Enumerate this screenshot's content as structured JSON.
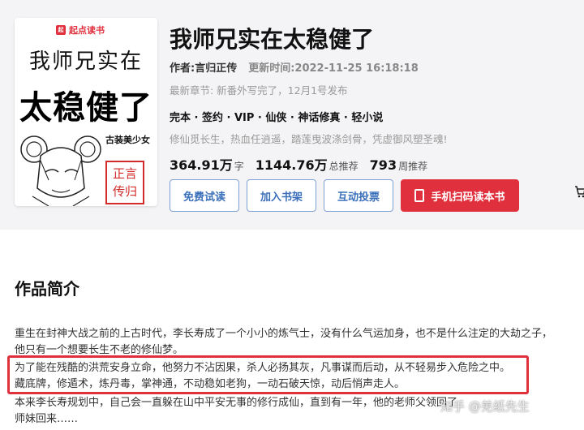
{
  "cover": {
    "logo_mark": "起点",
    "logo_text": "起点读书",
    "title_line1": "我师兄实在",
    "title_line2": "太稳健了",
    "tagline": "古装美少女",
    "seal_line1": "正言",
    "seal_line2": "传归"
  },
  "book": {
    "title": "我师兄实在太稳健了",
    "author_label": "作者:",
    "author": "言归正传",
    "updated_label": "更新时间:",
    "updated": "2022-11-25 16:18:18",
    "latest": "最新章节: 新番外写完了，12月1号发布",
    "tags": "完本 · 签约 · VIP · 仙侠 · 神话修真 · 轻小说",
    "description": "修仙觅长生，热血任逍遥，踏莲曳波涤剑骨，凭虚御风塑圣魂!",
    "stats": [
      {
        "value": "364.91万",
        "unit": "字"
      },
      {
        "value": "1144.76万",
        "unit": "总推荐"
      },
      {
        "value": "793",
        "unit": "周推荐"
      }
    ]
  },
  "actions": {
    "trial": "免费试读",
    "shelf": "加入书架",
    "vote": "互动投票",
    "scan": "手机扫码读本书"
  },
  "cart_icon": "cart-icon",
  "intro": {
    "heading": "作品简介",
    "lines": [
      "重生在封神大战之前的上古时代，李长寿成了一个小小的炼气士，没有什么气运加身，也不是什么注定的大劫之子，",
      "他只有一个想要长生不老的修仙梦。",
      "为了能在残酷的洪荒安身立命，他努力不沾因果，杀人必扬其灰，凡事谋而后动，从不轻易步入危险之中。",
      "藏底牌，修遁术，炼丹毒，掌神通，不动稳如老狗，一动石破天惊，动后悄声走人。",
      "本来李长寿规划中，自己会一直躲在山中平安无事的修行成仙，直到有一年，他的老师父领回了",
      "师妹回来……"
    ]
  },
  "watermark": "知乎 @羌纸先生",
  "accent": "#e0303d",
  "link_color": "#3a6fba"
}
